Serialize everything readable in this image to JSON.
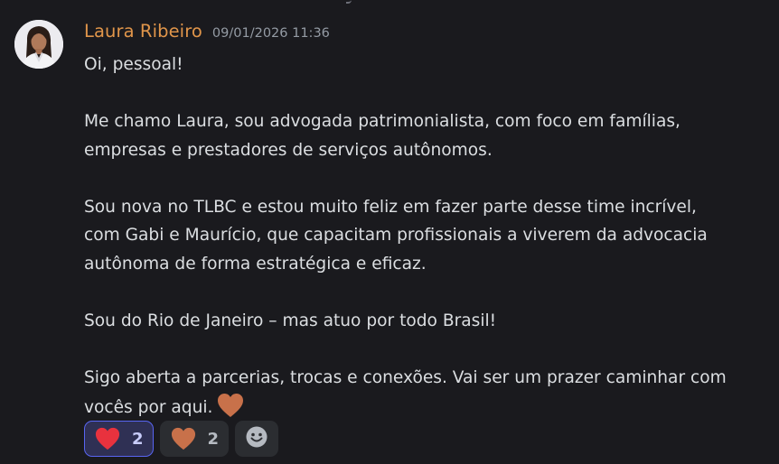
{
  "message": {
    "author": "Laura Ribeiro",
    "timestamp": "09/01/2026 11:36",
    "lines": [
      "Oi, pessoal!",
      "",
      "Me chamo Laura, sou advogada patrimonialista, com foco em famílias,",
      "empresas e prestadores de serviços autônomos.",
      "",
      "Sou nova no TLBC e estou muito feliz em fazer parte desse time incrível,",
      "com Gabi e Maurício, que capacitam profissionais a viverem da advocacia",
      "autônoma de forma estratégica e eficaz.",
      "",
      "Sou do Rio de Janeiro – mas atuo por todo Brasil!",
      "",
      "Sigo aberta a parcerias, trocas e conexões. Vai ser um prazer caminhar com",
      "vocês por aqui."
    ],
    "inline_emoji": "orange-heart-icon"
  },
  "reactions": [
    {
      "emoji": "red-heart-icon",
      "count": "2",
      "active": true
    },
    {
      "emoji": "orange-heart-icon",
      "count": "2",
      "active": false
    },
    {
      "emoji": "add-reaction-icon",
      "count": null,
      "active": false
    }
  ],
  "colors": {
    "background": "#1a1a1e",
    "username": "#e0954a",
    "text": "#dbdee1",
    "timestamp": "#949ba4",
    "reaction_bg": "#2b2d31",
    "reaction_active_bg": "#2f3054",
    "reaction_active_border": "#5865f2",
    "red_heart": "#e8323e",
    "orange_heart": "#c8714a"
  }
}
